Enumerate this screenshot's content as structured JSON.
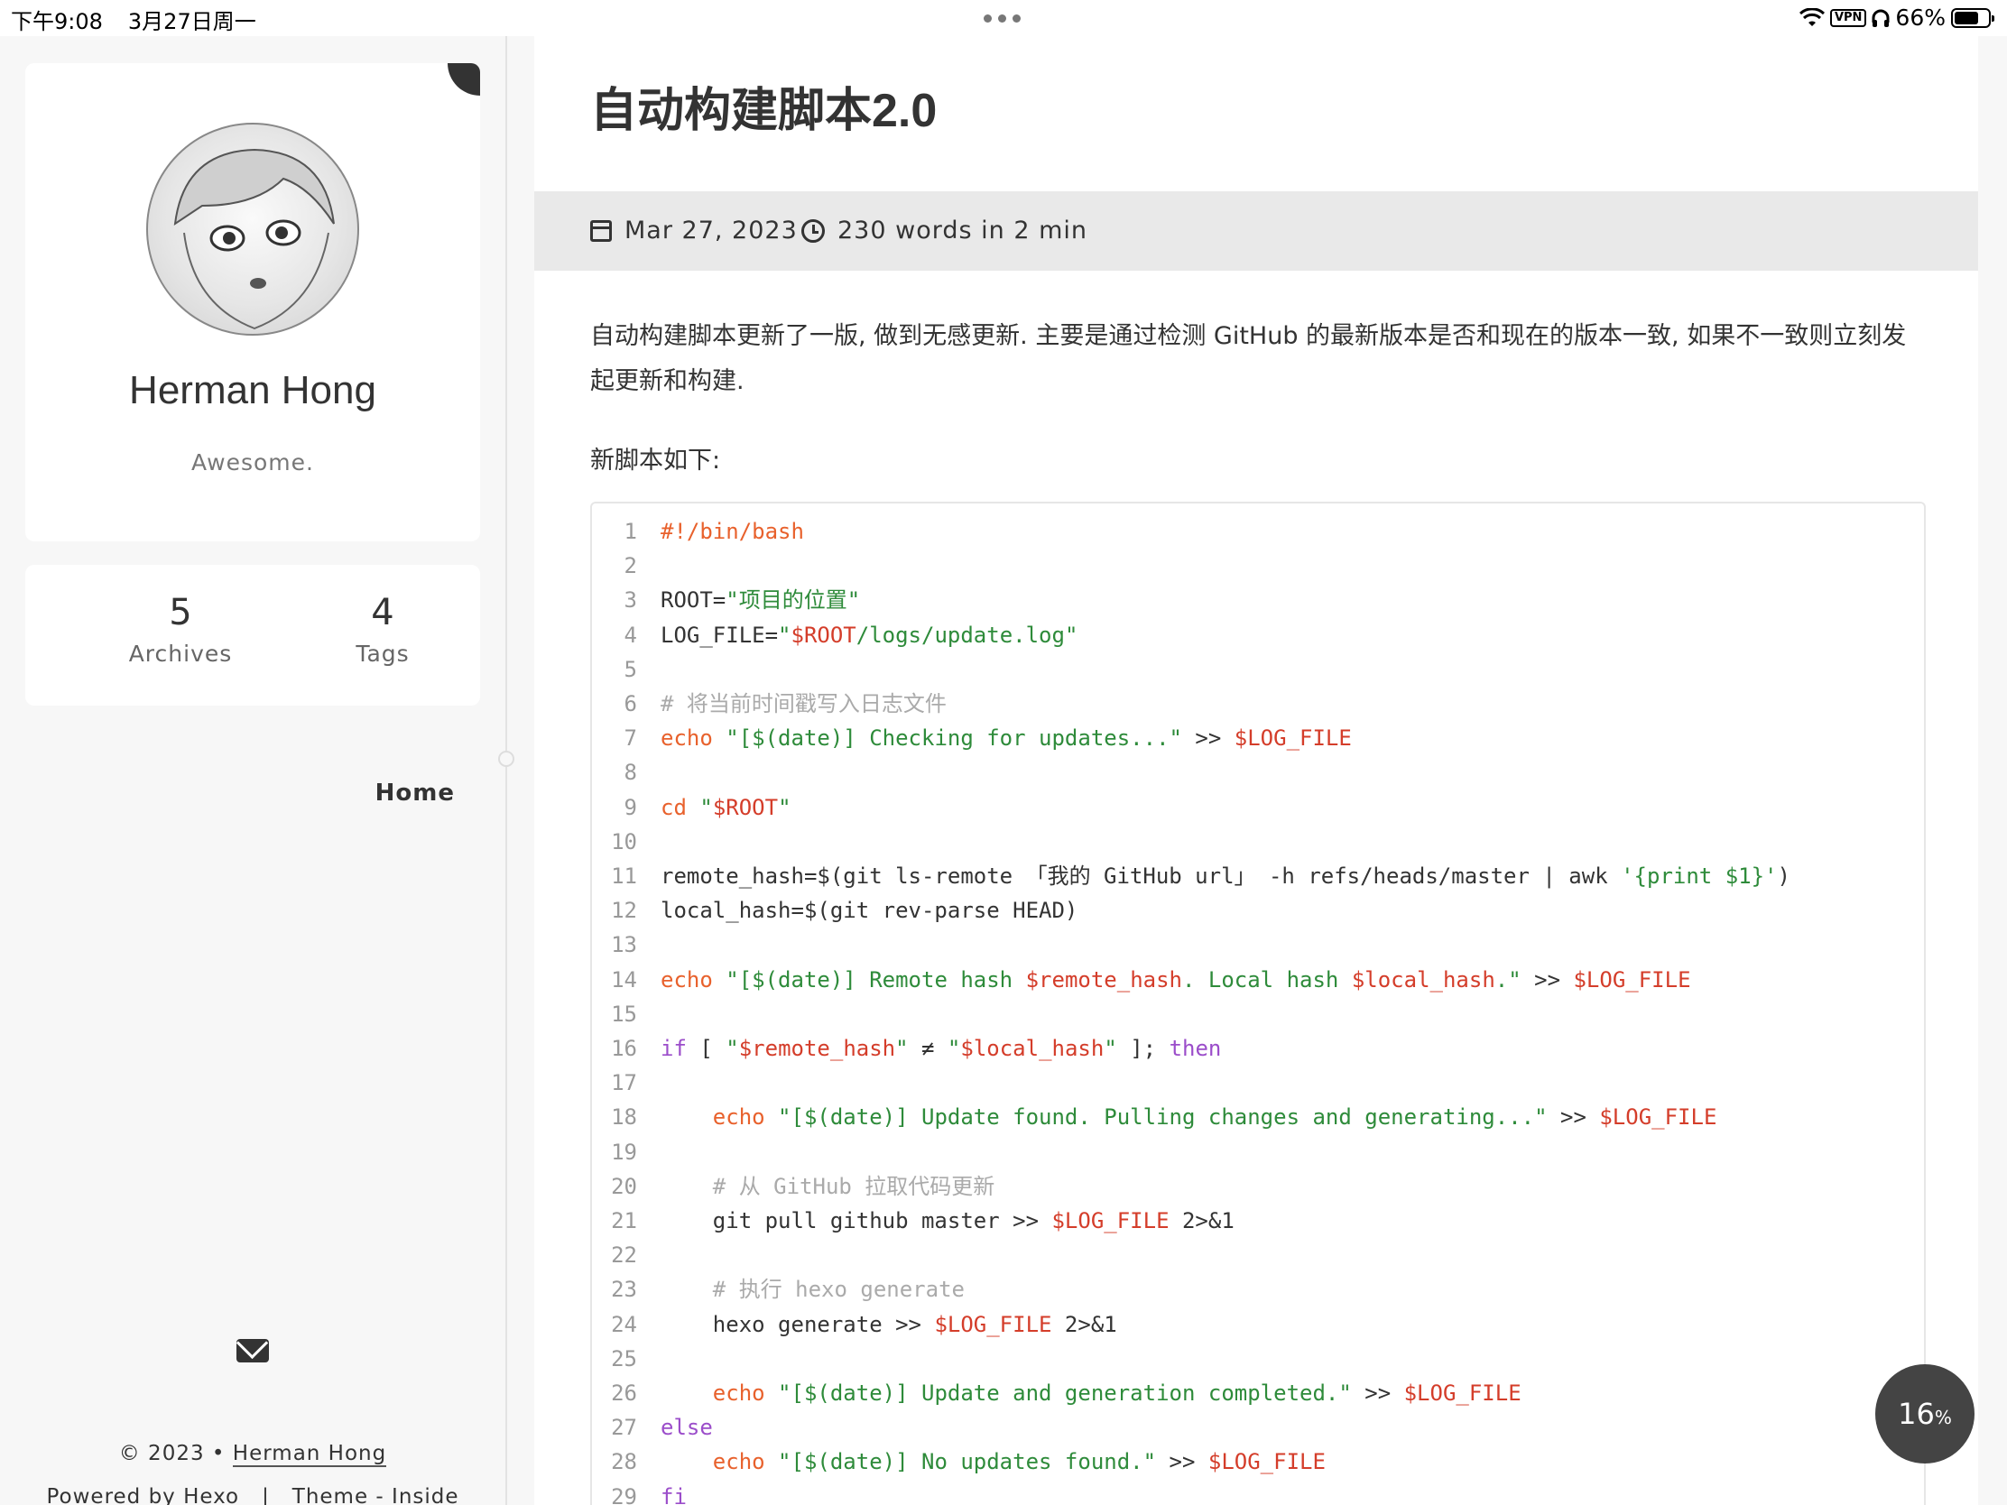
{
  "status_bar": {
    "time": "下午9:08",
    "date": "3月27日周一",
    "vpn": "VPN",
    "battery": "66%"
  },
  "sidebar": {
    "name": "Herman Hong",
    "description": "Awesome.",
    "stats": [
      {
        "num": "5",
        "label": "Archives"
      },
      {
        "num": "4",
        "label": "Tags"
      }
    ],
    "nav_home": "Home",
    "footer": {
      "copyright": "© 2023 •",
      "author": "Herman Hong",
      "powered_by": "Powered by",
      "hexo": "Hexo",
      "sep": "|",
      "theme": "Theme -",
      "inside": "Inside"
    }
  },
  "post": {
    "title": "自动构建脚本2.0",
    "date": "Mar 27, 2023",
    "reading": "230 words in 2 min",
    "para1": "自动构建脚本更新了一版, 做到无感更新. 主要是通过检测 GitHub 的最新版本是否和现在的版本一致, 如果不一致则立刻发起更新和构建.",
    "para2": "新脚本如下:",
    "code_lines": [
      [
        {
          "t": "#!/bin/bash",
          "c": "t-shb"
        }
      ],
      [],
      [
        {
          "t": "ROOT="
        },
        {
          "t": "\"项目的位置\"",
          "c": "t-str"
        }
      ],
      [
        {
          "t": "LOG_FILE="
        },
        {
          "t": "\"",
          "c": "t-str"
        },
        {
          "t": "$ROOT",
          "c": "t-var"
        },
        {
          "t": "/logs/update.log\"",
          "c": "t-str"
        }
      ],
      [],
      [
        {
          "t": "# 将当前时间戳写入日志文件",
          "c": "t-com"
        }
      ],
      [
        {
          "t": "echo",
          "c": "t-kw"
        },
        {
          "t": " "
        },
        {
          "t": "\"[$(date)] Checking for updates...\"",
          "c": "t-str"
        },
        {
          "t": " >> "
        },
        {
          "t": "$LOG_FILE",
          "c": "t-var"
        }
      ],
      [],
      [
        {
          "t": "cd",
          "c": "t-kw"
        },
        {
          "t": " "
        },
        {
          "t": "\"",
          "c": "t-str"
        },
        {
          "t": "$ROOT",
          "c": "t-var"
        },
        {
          "t": "\"",
          "c": "t-str"
        }
      ],
      [],
      [
        {
          "t": "remote_hash=$(git ls-remote 「我的 GitHub url」 -h refs/heads/master | awk "
        },
        {
          "t": "'{print $1}'",
          "c": "t-str"
        },
        {
          "t": ")"
        }
      ],
      [
        {
          "t": "local_hash=$(git rev-parse HEAD)"
        }
      ],
      [],
      [
        {
          "t": "echo",
          "c": "t-kw"
        },
        {
          "t": " "
        },
        {
          "t": "\"[$(date)] Remote hash ",
          "c": "t-str"
        },
        {
          "t": "$remote_hash",
          "c": "t-var"
        },
        {
          "t": ". Local hash ",
          "c": "t-str"
        },
        {
          "t": "$local_hash",
          "c": "t-var"
        },
        {
          "t": ".\"",
          "c": "t-str"
        },
        {
          "t": " >> "
        },
        {
          "t": "$LOG_FILE",
          "c": "t-var"
        }
      ],
      [],
      [
        {
          "t": "if",
          "c": "t-ctl"
        },
        {
          "t": " [ "
        },
        {
          "t": "\"",
          "c": "t-str"
        },
        {
          "t": "$remote_hash",
          "c": "t-var"
        },
        {
          "t": "\"",
          "c": "t-str"
        },
        {
          "t": " ≠ "
        },
        {
          "t": "\"",
          "c": "t-str"
        },
        {
          "t": "$local_hash",
          "c": "t-var"
        },
        {
          "t": "\"",
          "c": "t-str"
        },
        {
          "t": " ]; "
        },
        {
          "t": "then",
          "c": "t-ctl"
        }
      ],
      [],
      [
        {
          "t": "    "
        },
        {
          "t": "echo",
          "c": "t-kw"
        },
        {
          "t": " "
        },
        {
          "t": "\"[$(date)] Update found. Pulling changes and generating...\"",
          "c": "t-str"
        },
        {
          "t": " >> "
        },
        {
          "t": "$LOG_FILE",
          "c": "t-var"
        }
      ],
      [],
      [
        {
          "t": "    "
        },
        {
          "t": "# 从 GitHub 拉取代码更新",
          "c": "t-com"
        }
      ],
      [
        {
          "t": "    git pull github master >> "
        },
        {
          "t": "$LOG_FILE",
          "c": "t-var"
        },
        {
          "t": " 2>&1"
        }
      ],
      [],
      [
        {
          "t": "    "
        },
        {
          "t": "# 执行 hexo generate",
          "c": "t-com"
        }
      ],
      [
        {
          "t": "    hexo generate >> "
        },
        {
          "t": "$LOG_FILE",
          "c": "t-var"
        },
        {
          "t": " 2>&1"
        }
      ],
      [],
      [
        {
          "t": "    "
        },
        {
          "t": "echo",
          "c": "t-kw"
        },
        {
          "t": " "
        },
        {
          "t": "\"[$(date)] Update and generation completed.\"",
          "c": "t-str"
        },
        {
          "t": " >> "
        },
        {
          "t": "$LOG_FILE",
          "c": "t-var"
        }
      ],
      [
        {
          "t": "else",
          "c": "t-ctl"
        }
      ],
      [
        {
          "t": "    "
        },
        {
          "t": "echo",
          "c": "t-kw"
        },
        {
          "t": " "
        },
        {
          "t": "\"[$(date)] No updates found.\"",
          "c": "t-str"
        },
        {
          "t": " >> "
        },
        {
          "t": "$LOG_FILE",
          "c": "t-var"
        }
      ],
      [
        {
          "t": "fi",
          "c": "t-ctl"
        }
      ]
    ]
  },
  "progress": {
    "value": "16",
    "unit": "%"
  }
}
